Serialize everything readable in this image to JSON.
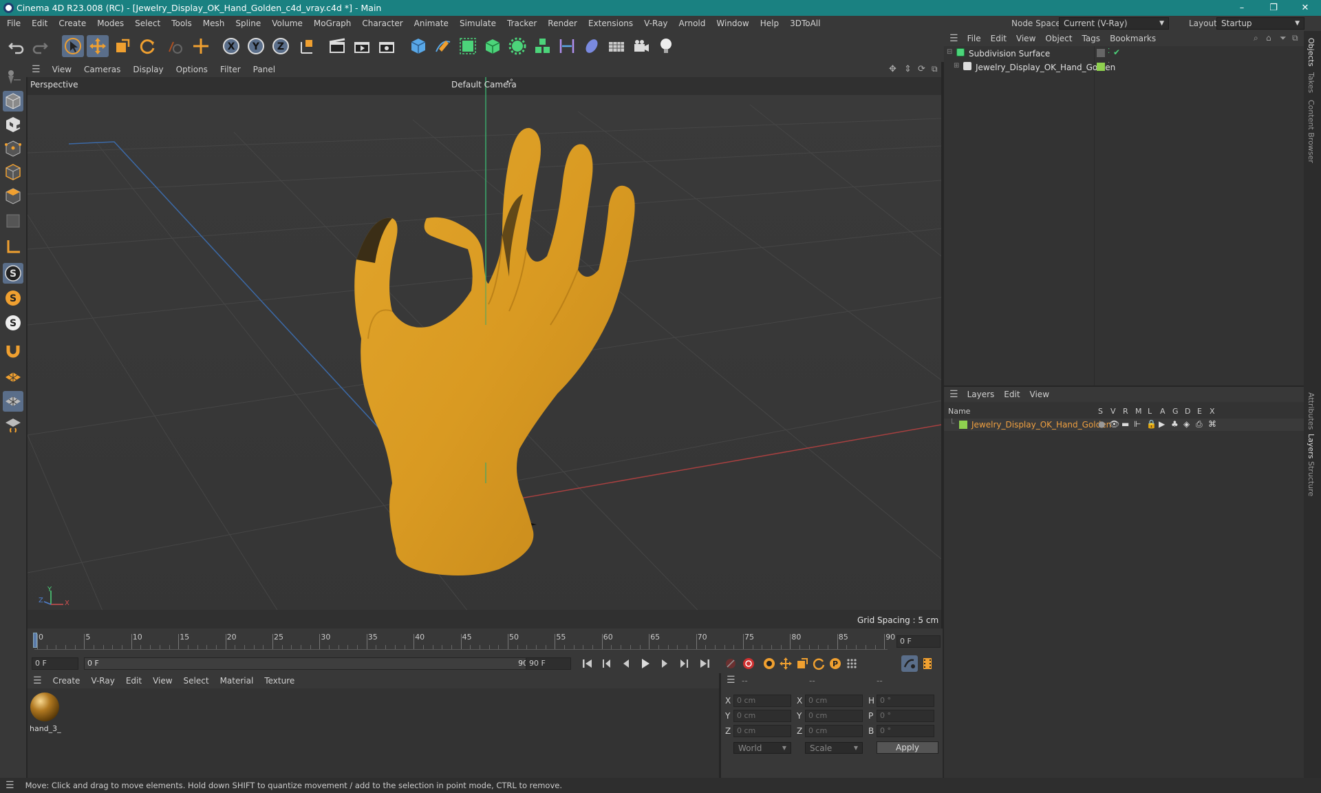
{
  "window": {
    "title": "Cinema 4D R23.008 (RC) - [Jewelry_Display_OK_Hand_Golden_c4d_vray.c4d *] - Main",
    "minimize": "–",
    "restore": "❐",
    "close": "✕"
  },
  "menubar": {
    "items": [
      "File",
      "Edit",
      "Create",
      "Modes",
      "Select",
      "Tools",
      "Mesh",
      "Spline",
      "Volume",
      "MoGraph",
      "Character",
      "Animate",
      "Simulate",
      "Tracker",
      "Render",
      "Extensions",
      "V-Ray",
      "Arnold",
      "Window",
      "Help",
      "3DToAll"
    ],
    "node_space_label": "Node Space:",
    "node_space_value": "Current (V-Ray)",
    "layout_label": "Layout:",
    "layout_value": "Startup"
  },
  "viewport": {
    "menu": [
      "View",
      "Cameras",
      "Display",
      "Options",
      "Filter",
      "Panel"
    ],
    "view_name": "Perspective",
    "camera": "Default Camera",
    "camera_marker": "•°",
    "grid_spacing": "Grid Spacing : 5 cm",
    "axis_y": "Y",
    "axis_z": "Z",
    "axis_x": "X"
  },
  "timeline": {
    "ticks": [
      "0",
      "5",
      "10",
      "15",
      "20",
      "25",
      "30",
      "35",
      "40",
      "45",
      "50",
      "55",
      "60",
      "65",
      "70",
      "75",
      "80",
      "85",
      "90"
    ],
    "current_frame": "0 F",
    "start_field": "0 F",
    "range_start": "0 F",
    "range_end": "90 F",
    "end_field": "90 F"
  },
  "materials": {
    "menu": [
      "Create",
      "V-Ray",
      "Edit",
      "View",
      "Select",
      "Material",
      "Texture"
    ],
    "items": [
      {
        "name": "hand_3_"
      }
    ]
  },
  "coords": {
    "headers": [
      "--",
      "--",
      "--"
    ],
    "rows": [
      {
        "a": "X",
        "av": "0 cm",
        "b": "X",
        "bv": "0 cm",
        "c": "H",
        "cv": "0 °"
      },
      {
        "a": "Y",
        "av": "0 cm",
        "b": "Y",
        "bv": "0 cm",
        "c": "P",
        "cv": "0 °"
      },
      {
        "a": "Z",
        "av": "0 cm",
        "b": "Z",
        "bv": "0 cm",
        "c": "B",
        "cv": "0 °"
      }
    ],
    "space": "World",
    "mode": "Scale",
    "apply": "Apply"
  },
  "objects": {
    "menu": [
      "File",
      "Edit",
      "View",
      "Object",
      "Tags",
      "Bookmarks"
    ],
    "items": [
      {
        "name": "Subdivision Surface"
      },
      {
        "name": "Jewelry_Display_OK_Hand_Golden"
      }
    ]
  },
  "layers": {
    "menu": [
      "Layers",
      "Edit",
      "View"
    ],
    "columns": {
      "name": "Name",
      "flags": [
        "S",
        "V",
        "R",
        "M",
        "L",
        "A",
        "G",
        "D",
        "E",
        "X"
      ]
    },
    "items": [
      {
        "name": "Jewelry_Display_OK_Hand_Golden"
      }
    ]
  },
  "side_tabs": {
    "top": [
      "Objects",
      "Takes",
      "Content Browser"
    ],
    "bottom": [
      "Attributes",
      "Layers",
      "Structure"
    ]
  },
  "status": {
    "text": "Move: Click and drag to move elements. Hold down SHIFT to quantize movement / add to the selection in point mode, CTRL to remove."
  },
  "colors": {
    "titlebar": "#1a8181",
    "hand": "#d99a22",
    "layer_color": "#8fd14f",
    "layer_name": "#f0a040",
    "accent_orange": "#f0a030"
  }
}
